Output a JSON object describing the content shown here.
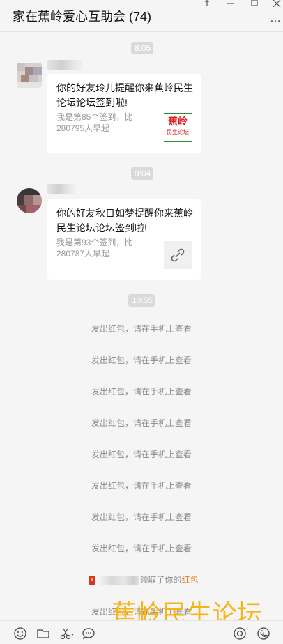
{
  "header": {
    "title": "家在蕉岭爱心互助会 (74)",
    "more_label": "…"
  },
  "messages": {
    "time1": "8:05",
    "time2": "9:04",
    "time3": "10:55",
    "card1": {
      "title": "你的好友玲儿提醒你来蕉岭民生论坛论坛签到啦!",
      "desc": "我是第85个签到，比280795人早起",
      "thumb_text_top": "蕉岭",
      "thumb_text_bottom": "民生论坛"
    },
    "card2": {
      "title": "你的好友秋日如梦提醒你来蕉岭民生论坛论坛签到啦!",
      "desc": "我是第93个签到，比280787人早起",
      "thumb_icon": "link-icon"
    },
    "system": [
      "发出红包，请在手机上查看",
      "发出红包，请在手机上查看",
      "发出红包，请在手机上查看",
      "发出红包，请在手机上查看",
      "发出红包，请在手机上查看",
      "发出红包，请在手机上查看",
      "发出红包，请在手机上查看",
      "发出红包，请在手机上查看",
      "发出红包，请在手机上查看"
    ],
    "redpacket_notice": {
      "text": "领取了你的",
      "highlight": "红包",
      "highlight_color": "#e07b1e"
    }
  },
  "toolbar": {
    "icons": [
      "emoji-icon",
      "folder-icon",
      "scissors-icon",
      "chat-icon",
      "record-icon",
      "video-call-icon"
    ]
  },
  "watermark": "蕉岭民生论坛",
  "colors": {
    "background": "#f5f5f5",
    "bubble": "#ffffff",
    "time_badge": "#dadada",
    "watermark": "#f7b419"
  }
}
